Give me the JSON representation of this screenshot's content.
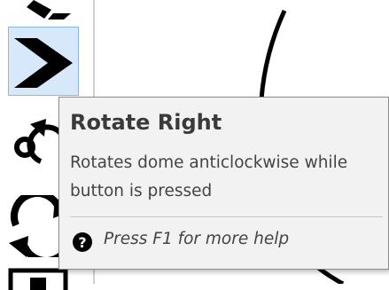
{
  "toolbar": {
    "tools": [
      {
        "icon": "partial-toolbar-icon"
      },
      {
        "icon": "chevron-right-icon",
        "state": "hovered"
      },
      {
        "icon": "rotate-anticlockwise-icon"
      },
      {
        "icon": "refresh-icon"
      },
      {
        "icon": "partial-toolbar-icon"
      }
    ]
  },
  "tooltip": {
    "title": "Rotate Right",
    "description": "Rotates dome anticlockwise while button is pressed",
    "help_icon": "help-icon",
    "help_text": "Press F1 for more help"
  },
  "colors": {
    "hover_background": "#d7e8fa",
    "hover_border": "#8db7e8",
    "tooltip_background": "#f2f2f2",
    "icon": "#000000",
    "text": "#444444"
  }
}
